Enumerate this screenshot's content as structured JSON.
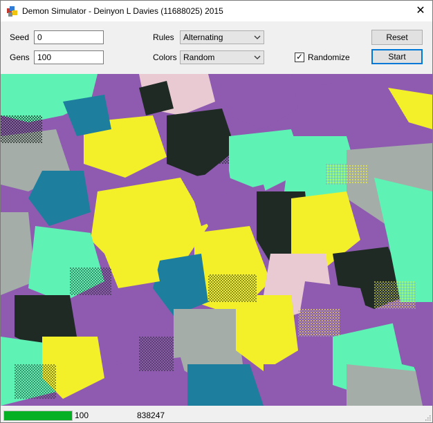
{
  "window": {
    "title": "Demon Simulator - Deinyon L Davies (11688025) 2015",
    "close_glyph": "✕"
  },
  "controls": {
    "seed_label": "Seed",
    "seed_value": "0",
    "gens_label": "Gens",
    "gens_value": "100",
    "rules_label": "Rules",
    "rules_value": "Alternating",
    "colors_label": "Colors",
    "colors_value": "Random",
    "randomize_label": "Randomize",
    "randomize_checked": true,
    "checkmark": "✓",
    "reset_label": "Reset",
    "start_label": "Start"
  },
  "canvas": {
    "description_colors": [
      "#8e5bb1",
      "#f3f029",
      "#5ef3b4",
      "#1e7e9e",
      "#1f2a24",
      "#e9cad2",
      "#a4ada7"
    ]
  },
  "status": {
    "progress_fraction": 1.0,
    "generation": "100",
    "count": "838247"
  },
  "colors": {
    "progress": "#06b025",
    "accent": "#0078d7"
  }
}
